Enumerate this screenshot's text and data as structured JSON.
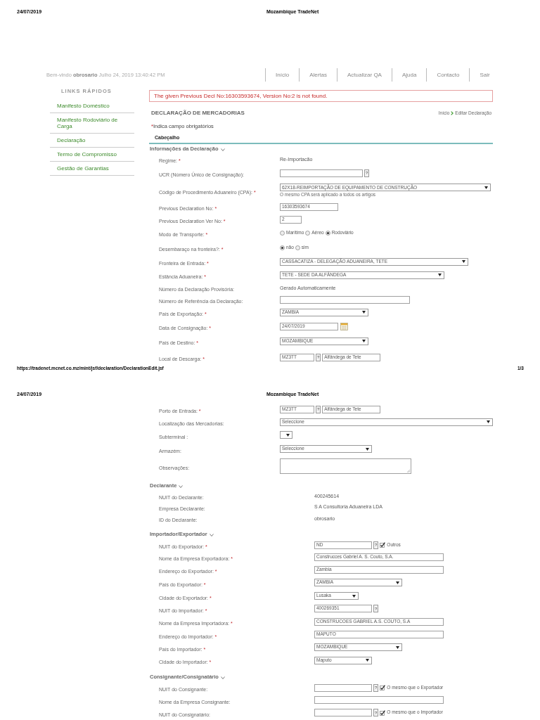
{
  "pages": [
    {
      "header": {
        "date": "24/07/2019",
        "title": "Mozambique TradeNet"
      },
      "sections": [
        {
          "title": "Informações da Declaração",
          "expanded": true,
          "rows": [
            {
              "label": "Regime:",
              "required_mark": "*",
              "controls": [
                {
                  "kind": "text",
                  "value": "Re-Importacão"
                }
              ]
            },
            {
              "label": "UCR (Número Único de Consignação):",
              "controls": [
                {
                  "kind": "input"
                },
                {
                  "kind": "help",
                  "text": "?"
                }
              ]
            },
            {
              "label": "Código de Procedimento Aduaneiro (CPA):",
              "required_mark": "*",
              "controls": [
                {
                  "kind": "select",
                  "value": "62X18-REIMPORTAÇÃO DE EQUIPAMENTO DE CONSTRUÇÃO"
                }
              ],
              "note": "O mesmo CPA será aplicado a todos os artigos"
            },
            {
              "label": "Previous Declaration No:",
              "required_mark": "*",
              "controls": [
                {
                  "kind": "input",
                  "value": "16303593674"
                }
              ]
            },
            {
              "label": "Previous Declaration Ver No:",
              "required_mark": "*",
              "controls": [
                {
                  "kind": "input",
                  "value": "2"
                }
              ]
            },
            {
              "label": "Modo de Transporte:",
              "required_mark": "*",
              "controls": [
                {
                  "kind": "radio",
                  "label": "Marítimo",
                  "selected": false
                },
                {
                  "kind": "radio",
                  "label": "Aéreo",
                  "selected": false
                },
                {
                  "kind": "radio",
                  "label": "Rodoviário",
                  "selected": true
                }
              ]
            },
            {
              "label": "Desembaraço na fronteira?:",
              "required_mark": "*",
              "controls": [
                {
                  "kind": "radio",
                  "label": "não",
                  "selected": true
                },
                {
                  "kind": "radio",
                  "label": "sim",
                  "selected": false
                }
              ]
            },
            {
              "label": "Fronteira de Entrada:",
              "required_mark": "*",
              "controls": [
                {
                  "kind": "select",
                  "value": "CASSACATIZA - DELEGAÇÃO ADUANEIRA, TETE"
                }
              ]
            },
            {
              "label": "Estância Aduaneira:",
              "required_mark": "*",
              "controls": [
                {
                  "kind": "select",
                  "value": "TETE - SEDE DA ALFÂNDEGA"
                }
              ]
            },
            {
              "label": "Número da Declaração Provisória:",
              "controls": [
                {
                  "kind": "text",
                  "value": "Gerado Automaticamente"
                }
              ]
            },
            {
              "label": "Número de Referência da Declaração:",
              "controls": [
                {
                  "kind": "input"
                }
              ]
            },
            {
              "label": "País de Exportação:",
              "required_mark": "*",
              "controls": [
                {
                  "kind": "select",
                  "value": "ZAMBIA"
                }
              ]
            },
            {
              "label": "Data de Consignação:",
              "required_mark": "*",
              "controls": [
                {
                  "kind": "input",
                  "value": "24/07/2019"
                },
                {
                  "kind": "calendar"
                }
              ]
            },
            {
              "label": "País de Destino:",
              "required_mark": "*",
              "controls": [
                {
                  "kind": "select",
                  "value": "MOZAMBIQUE"
                }
              ]
            },
            {
              "label": "Local de Descarga:",
              "required_mark": "*",
              "controls": [
                {
                  "kind": "input",
                  "value": "MZ3TT"
                },
                {
                  "kind": "help",
                  "text": "?"
                },
                {
                  "kind": "input",
                  "value": "Alfândega de Tete"
                }
              ]
            }
          ]
        }
      ],
      "footer": {
        "url": "https://tradenet.mcnet.co.mz/mint/jsf/declaration/DeclarationEdit.jsf",
        "page_number": "1/3"
      }
    },
    {
      "header": {
        "date": "24/07/2019",
        "title": "Mozambique TradeNet"
      },
      "sections": [
        {
          "rows": [
            {
              "label": "Porto de Entrada:",
              "required_mark": "*",
              "controls": [
                {
                  "kind": "input",
                  "value": "MZ3TT"
                },
                {
                  "kind": "help",
                  "text": "?"
                },
                {
                  "kind": "input",
                  "value": "Alfândega de Tete"
                }
              ]
            },
            {
              "label": "Localização das Mercadorias:",
              "controls": [
                {
                  "kind": "select",
                  "value": "Seleccione"
                }
              ]
            },
            {
              "label": "Subterminal :",
              "controls": [
                {
                  "kind": "select"
                }
              ]
            },
            {
              "label": "Armazém:",
              "controls": [
                {
                  "kind": "select",
                  "value": "Seleccione"
                }
              ]
            },
            {
              "label": "Observações:",
              "controls": [
                {
                  "kind": "textarea"
                }
              ]
            }
          ]
        },
        {
          "title": "Declarante",
          "expanded": true,
          "rows": [
            {
              "label": "NUIT do Declarante:",
              "controls": [
                {
                  "kind": "text",
                  "value": "400245614"
                }
              ]
            },
            {
              "label": "Empresa Declarante:",
              "controls": [
                {
                  "kind": "text",
                  "value": "S A Consultoria Aduaneira LDA"
                }
              ]
            },
            {
              "label": "ID do Declarante:",
              "controls": [
                {
                  "kind": "text",
                  "value": "obrosario"
                }
              ]
            }
          ]
        },
        {
          "title": "Importador/Exportador",
          "expanded": true,
          "rows": [
            {
              "label": "NUIT do Exportador:",
              "required_mark": "*",
              "controls": [
                {
                  "kind": "input",
                  "value": "ND"
                },
                {
                  "kind": "help",
                  "text": "?"
                },
                {
                  "kind": "checkbox",
                  "checked": true,
                  "label": "Outros"
                }
              ]
            },
            {
              "label": "Nome da Empresa Exportadora:",
              "required_mark": "*",
              "controls": [
                {
                  "kind": "input",
                  "value": "Construcces Gabriel A. S. Couto, S.A."
                }
              ]
            },
            {
              "label": "Endereço do Exportador:",
              "required_mark": "*",
              "controls": [
                {
                  "kind": "input",
                  "value": "Zambia"
                }
              ]
            },
            {
              "label": "País do Exportador:",
              "required_mark": "*",
              "controls": [
                {
                  "kind": "select",
                  "value": "ZAMBIA"
                }
              ]
            },
            {
              "label": "Cidade do Exportador:",
              "required_mark": "*",
              "controls": [
                {
                  "kind": "select",
                  "value": "Lusaka"
                }
              ]
            },
            {
              "label": "NUIT do Importador:",
              "required_mark": "*",
              "controls": [
                {
                  "kind": "input",
                  "value": "400269351"
                },
                {
                  "kind": "help",
                  "text": "?"
                }
              ]
            },
            {
              "label": "Nome da Empresa Importadora:",
              "required_mark": "*",
              "controls": [
                {
                  "kind": "input",
                  "value": "CONSTRUCOES GABRIEL A.S. COUTO, S.A"
                }
              ]
            },
            {
              "label": "Endereço do Importador:",
              "required_mark": "*",
              "controls": [
                {
                  "kind": "input",
                  "value": "MAPUTO"
                }
              ]
            },
            {
              "label": "País do Importador:",
              "required_mark": "*",
              "controls": [
                {
                  "kind": "select",
                  "value": "MOZAMBIQUE"
                }
              ]
            },
            {
              "label": "Cidade do Importador:",
              "required_mark": "*",
              "controls": [
                {
                  "kind": "select",
                  "value": "Maputo"
                }
              ]
            }
          ]
        },
        {
          "title": "Consignante/Consignatário",
          "expanded": true,
          "rows": [
            {
              "label": "NUIT do Consignante:",
              "controls": [
                {
                  "kind": "input"
                },
                {
                  "kind": "help",
                  "text": "?"
                },
                {
                  "kind": "checkbox",
                  "checked": true,
                  "label": "O mesmo que o Exportador"
                }
              ]
            },
            {
              "label": "Nome da Empresa Consignante:",
              "controls": [
                {
                  "kind": "input"
                }
              ]
            },
            {
              "label": "NUIT do Consignatário:",
              "controls": [
                {
                  "kind": "input"
                },
                {
                  "kind": "help",
                  "text": "?"
                },
                {
                  "kind": "checkbox",
                  "checked": true,
                  "label": "O mesmo que o Importador"
                }
              ]
            }
          ]
        }
      ]
    }
  ],
  "welcome": "Bem-vindo **obrosario** Julho 24, 2019 13:40:42 PM",
  "nav": [
    {
      "label": "Início"
    },
    {
      "label": "Alertas"
    },
    {
      "label": "Actualizar QA"
    },
    {
      "label": "Ajuda"
    },
    {
      "label": "Contacto"
    },
    {
      "label": "Sair"
    }
  ],
  "sidebar": {
    "title": "LINKS RÁPIDOS",
    "items": [
      {
        "label": "Manifesto Doméstico"
      },
      {
        "label": "Manifesto Rodoviário de Carga"
      },
      {
        "label": "Declaração"
      },
      {
        "label": "Termo de Compromisso"
      },
      {
        "label": "Gestão de Garantias"
      }
    ]
  },
  "alert": "The given Previous Decl No:16303593674, Version No:2 is not found.",
  "page_title": "DECLARAÇÃO DE MERCADORIAS",
  "breadcrumb": [
    "Início",
    "Editar Declaração"
  ],
  "required_note": {
    "mark": "*",
    "text": "Indica campo obrigatórios"
  },
  "tabs": [
    {
      "label": "Cabeçalho",
      "selected": true
    }
  ]
}
